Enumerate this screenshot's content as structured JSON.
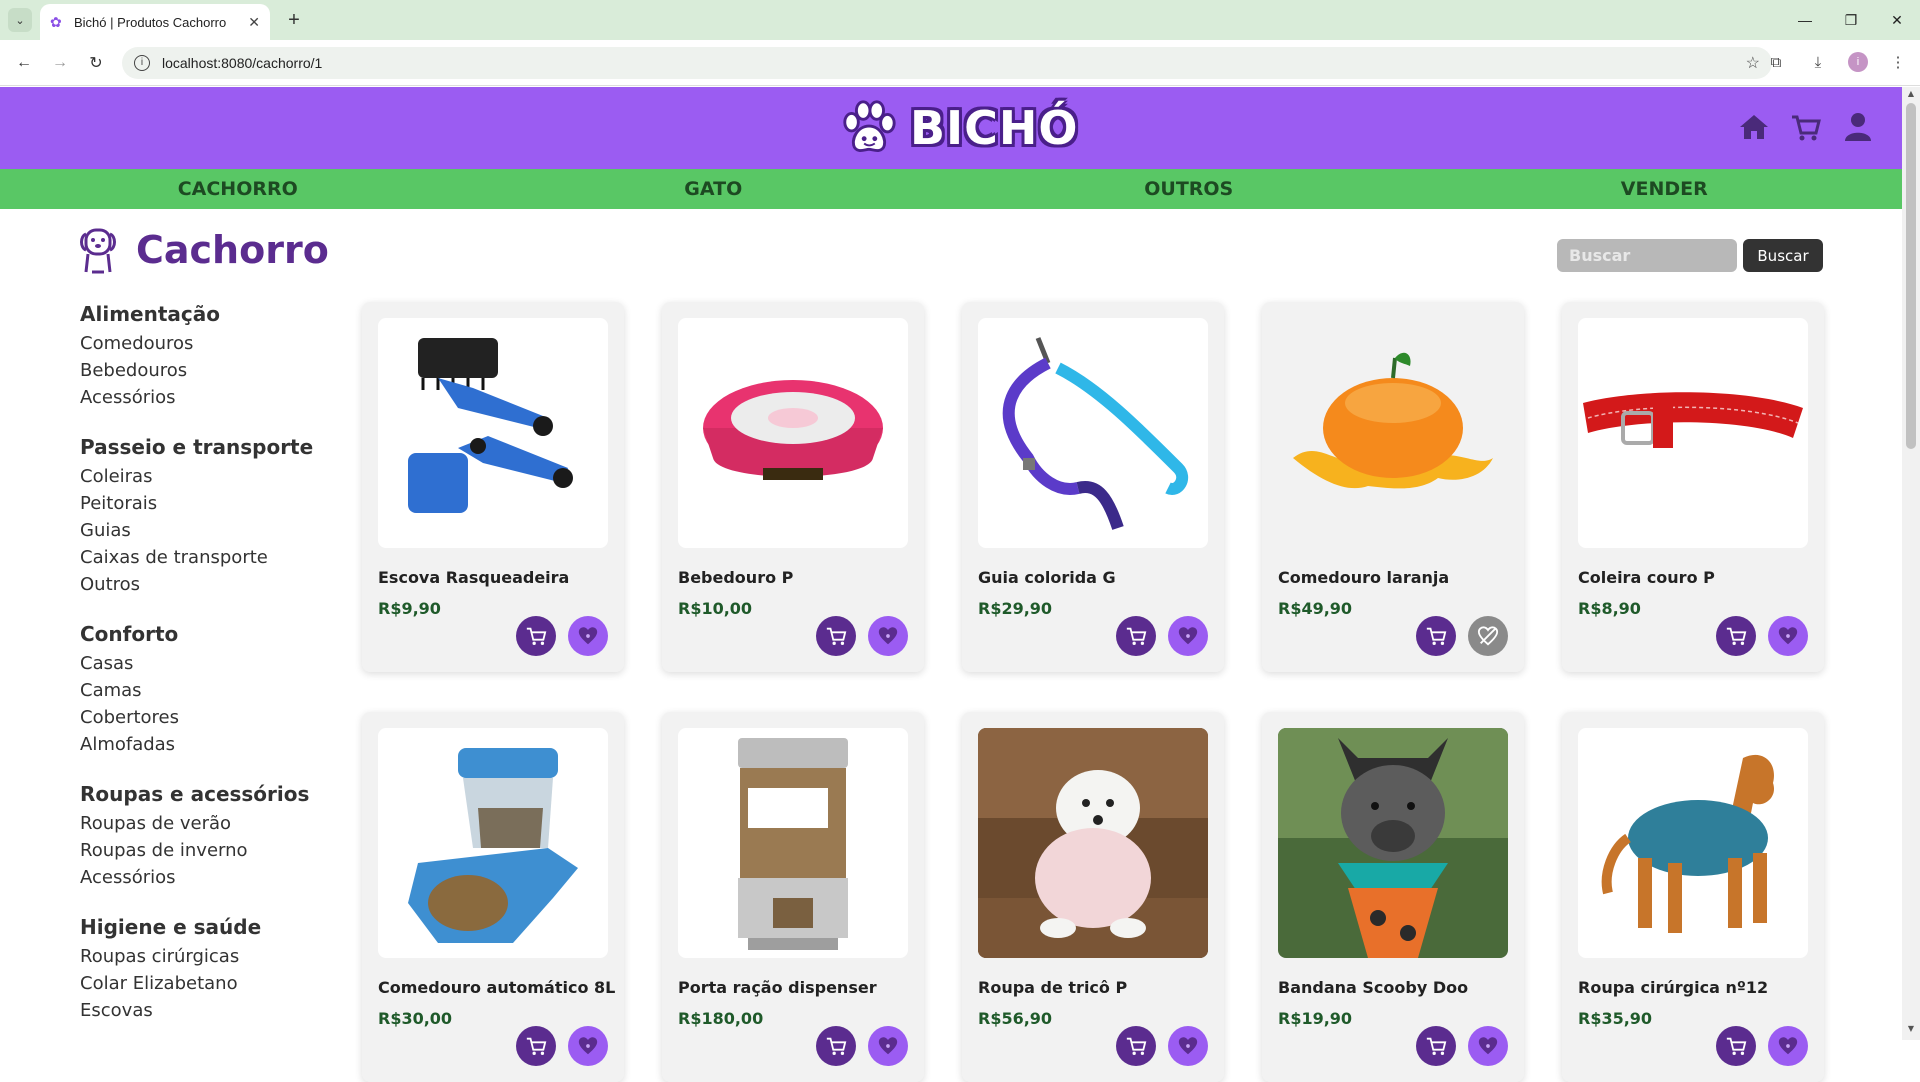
{
  "browser": {
    "tab_title": "Bichó | Produtos Cachorro",
    "url": "localhost:8080/cachorro/1"
  },
  "site": {
    "brand": "BICHÓ",
    "nav": [
      "CACHORRO",
      "GATO",
      "OUTROS",
      "VENDER"
    ]
  },
  "page": {
    "title": "Cachorro",
    "search_placeholder": "Buscar",
    "search_button": "Buscar"
  },
  "sidebar": [
    {
      "title": "Alimentação",
      "items": [
        "Comedouros",
        "Bebedouros",
        "Acessórios"
      ]
    },
    {
      "title": "Passeio e transporte",
      "items": [
        "Coleiras",
        "Peitorais",
        "Guias",
        "Caixas de transporte",
        "Outros"
      ]
    },
    {
      "title": "Conforto",
      "items": [
        "Casas",
        "Camas",
        "Cobertores",
        "Almofadas"
      ]
    },
    {
      "title": "Roupas e acessórios",
      "items": [
        "Roupas de verão",
        "Roupas de inverno",
        "Acessórios"
      ]
    },
    {
      "title": "Higiene e saúde",
      "items": [
        "Roupas cirúrgicas",
        "Colar Elizabetano",
        "Escovas"
      ]
    }
  ],
  "products": [
    {
      "name": "Escova Rasqueadeira",
      "price": "R$9,90",
      "image": "brush",
      "favorite_available": true
    },
    {
      "name": "Bebedouro P",
      "price": "R$10,00",
      "image": "pink-bowl",
      "favorite_available": true
    },
    {
      "name": "Guia colorida G",
      "price": "R$29,90",
      "image": "leash",
      "favorite_available": true
    },
    {
      "name": "Comedouro laranja",
      "price": "R$49,90",
      "image": "orange-bowl",
      "favorite_available": false
    },
    {
      "name": "Coleira couro P",
      "price": "R$8,90",
      "image": "red-collar",
      "favorite_available": true
    },
    {
      "name": "Comedouro automático 8L",
      "price": "R$30,00",
      "image": "auto-feeder",
      "favorite_available": true
    },
    {
      "name": "Porta ração dispenser",
      "price": "R$180,00",
      "image": "dispenser",
      "favorite_available": true
    },
    {
      "name": "Roupa de tricô P",
      "price": "R$56,90",
      "image": "westie-sweater",
      "favorite_available": true
    },
    {
      "name": "Bandana Scooby Doo",
      "price": "R$19,90",
      "image": "dog-bandana",
      "favorite_available": true
    },
    {
      "name": "Roupa cirúrgica nº12",
      "price": "R$35,90",
      "image": "golden-suit",
      "favorite_available": true
    }
  ],
  "colors": {
    "header": "#9b5cf2",
    "nav": "#59c765",
    "title": "#5b2c8f"
  }
}
